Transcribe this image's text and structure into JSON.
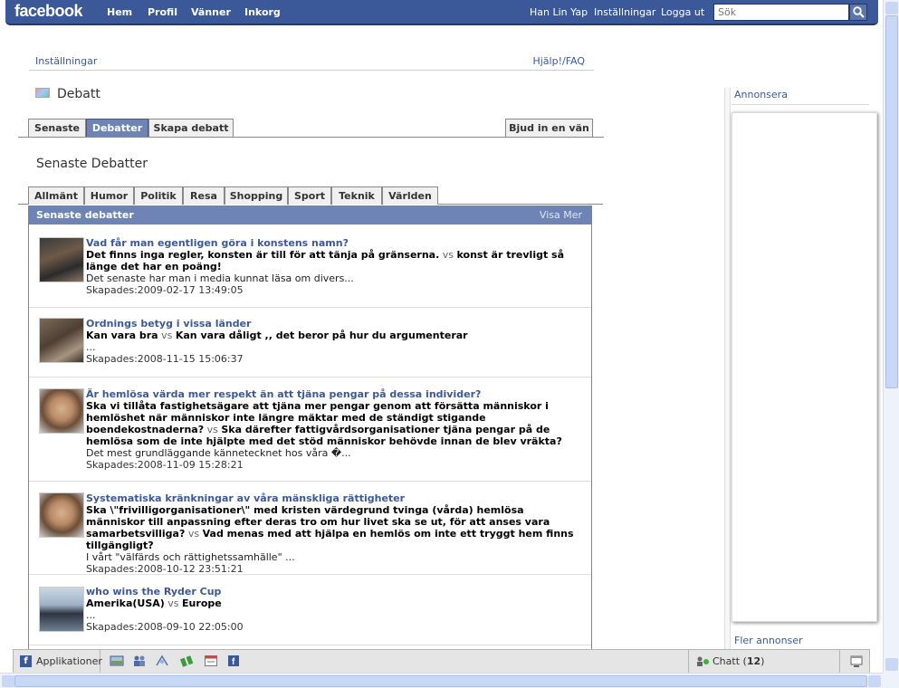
{
  "topbar": {
    "logo": "facebook",
    "nav": [
      "Hem",
      "Profil",
      "Vänner",
      "Inkorg"
    ],
    "user": "Han Lin Yap",
    "settings": "Inställningar",
    "logout": "Logga ut",
    "search_placeholder": "Sök",
    "brand_color": "#3b5998"
  },
  "page": {
    "settings_link": "Inställningar",
    "faq_link": "Hjälp!/FAQ",
    "title": "Debatt",
    "tabs": [
      "Senaste",
      "Debatter",
      "Skapa debatt"
    ],
    "active_tab": "Debatter",
    "invite_button": "Bjud in en vän",
    "section_title": "Senaste Debatter",
    "categories": [
      "Allmänt",
      "Humor",
      "Politik",
      "Resa",
      "Shopping",
      "Sport",
      "Teknik",
      "Världen"
    ]
  },
  "list": {
    "header": "Senaste debatter",
    "more": "Visa Mer",
    "items": [
      {
        "title": "Vad får man egentligen göra i konstens namn?",
        "side_a": "Det finns inga regler, konsten är till för att tänja på gränserna.",
        "vs": "vs",
        "side_b": "konst är trevligt så länge det har en poäng!",
        "snippet": "Det senaste har man i media kunnat läsa om divers...",
        "created": "Skapades:2009-02-17 13:49:05"
      },
      {
        "title": "Ordnings betyg i vissa länder",
        "side_a": "Kan vara bra",
        "vs": "vs",
        "side_b": "Kan vara dåligt ,, det beror på hur du argumenterar",
        "snippet": "...",
        "created": "Skapades:2008-11-15 15:06:37"
      },
      {
        "title": "Är hemlösa värda mer respekt än att tjäna pengar på dessa individer?",
        "side_a": "Ska vi tillåta fastighetsägare att tjäna mer pengar genom att försätta människor i hemlöshet när människor inte längre mäktar med de ständigt stigande boendekostnaderna?",
        "vs": "vs",
        "side_b": "Ska därefter fattigvårdsorganisationer tjäna pengar på de hemlösa som de inte hjälpte med det stöd människor behövde innan de blev vräkta?",
        "snippet": "Det mest grundläggande kännetecknet hos våra �...",
        "created": "Skapades:2008-11-09 15:28:21"
      },
      {
        "title": "Systematiska kränkningar av våra mänskliga rättigheter",
        "side_a": "Ska \\\"frivilligorganisationer\\\" med kristen värdegrund tvinga (vårda) hemlösa människor till anpassning efter deras tro om hur livet ska se ut, för att anses vara samarbetsvilliga?",
        "vs": "vs",
        "side_b": "Vad menas med att hjälpa en hemlös om inte ett tryggt hem finns tillgängligt?",
        "snippet": "I vårt \"välfärds och rättighetssamhälle\" ...",
        "created": "Skapades:2008-10-12 23:51:21"
      },
      {
        "title": "who wins the Ryder Cup",
        "side_a": "Amerika(USA)",
        "vs": "vs",
        "side_b": "Europe",
        "snippet": "...",
        "created": "Skapades:2008-09-10 22:05:00"
      }
    ]
  },
  "right": {
    "advertise": "Annonsera",
    "more_ads": "Fler annonser"
  },
  "chatbar": {
    "applications": "Applikationer",
    "chat_label": "Chatt (",
    "chat_count": "12",
    "chat_close": ")"
  }
}
